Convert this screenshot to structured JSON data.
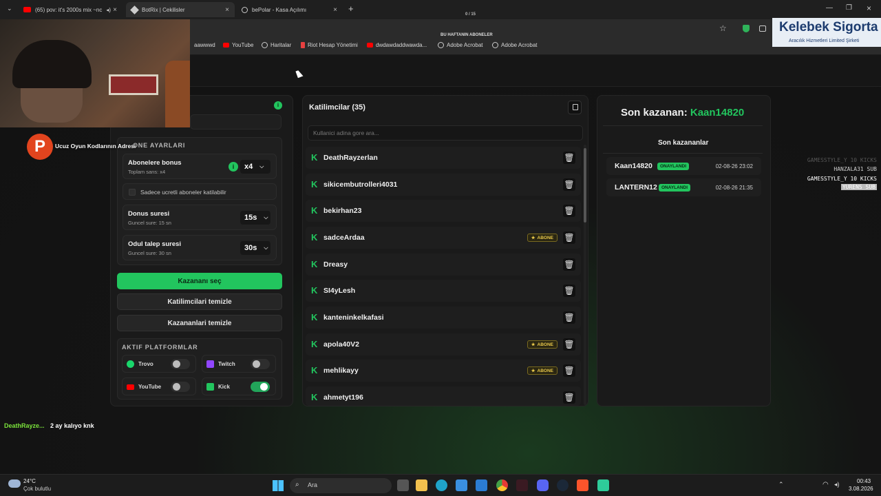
{
  "browser": {
    "tabs": [
      {
        "label": "(65) pov: it's 2000s mix ~nc",
        "icon": "youtube-icon"
      },
      {
        "label": "BotRix | Cekilisler",
        "icon": "botrix-icon"
      },
      {
        "label": "bePolar - Kasa Açılımı",
        "icon": "globe-icon"
      }
    ],
    "counter": "0 / 15",
    "banner_text": "BU HAFTANIN ABONELER",
    "bookmarks": [
      "aawwwd",
      "YouTube",
      "Haritalar",
      "Riot Hesap Yönetimi",
      "dwdawdaddwawda...",
      "Adobe Acrobat",
      "Adobe Acrobat"
    ]
  },
  "overlay": {
    "title": "Ucuz Oyun Kodlarının Adresi",
    "logo_letter": "P",
    "sponsor_name": "Kelebek Sigorta",
    "sponsor_sub": "Aracılık Hizmetleri Limited Şirketi"
  },
  "settings": {
    "section_title": "ONE AYARLARI",
    "subscriber_bonus_label": "Abonelere bonus",
    "subscriber_bonus_sub": "Toplam sans: x4",
    "subscriber_bonus_value": "x4",
    "paid_only_label": "Sadece ucretli aboneler katilabilir",
    "bonus_time_label": "Donus suresi",
    "bonus_time_sub": "Guncel sure: 15 sn",
    "bonus_time_value": "15s",
    "claim_time_label": "Odul talep suresi",
    "claim_time_sub": "Guncel sure: 30 sn",
    "claim_time_value": "30s",
    "pick_winner": "Kazananı seç",
    "clear_participants": "Katilimcilari temizle",
    "clear_winners": "Kazananlari temizle",
    "platforms_title": "AKTIF PLATFORMLAR",
    "platforms": [
      {
        "name": "Trovo",
        "color": "#19d66b",
        "on": false
      },
      {
        "name": "Twitch",
        "color": "#9146ff",
        "on": false
      },
      {
        "name": "YouTube",
        "color": "#ff0000",
        "on": false
      },
      {
        "name": "Kick",
        "color": "#22c55e",
        "on": true
      }
    ]
  },
  "participants": {
    "title": "Katilimcilar (35)",
    "search_placeholder": "Kullanici adina gore ara...",
    "abone_label": "ABONE",
    "items": [
      {
        "name": "DeathRayzerlan",
        "sub": false
      },
      {
        "name": "sikicembutrolleri4031",
        "sub": false
      },
      {
        "name": "bekirhan23",
        "sub": false
      },
      {
        "name": "sadceArdaa",
        "sub": true
      },
      {
        "name": "Dreasy",
        "sub": false
      },
      {
        "name": "SI4yLesh",
        "sub": false
      },
      {
        "name": "kanteninkelkafasi",
        "sub": false
      },
      {
        "name": "apola40V2",
        "sub": true
      },
      {
        "name": "mehlikayy",
        "sub": true
      },
      {
        "name": "ahmetyt196",
        "sub": false
      }
    ]
  },
  "winners": {
    "last_winner_label": "Son kazanan:",
    "last_winner": "Kaan14820",
    "recent_title": "Son kazananlar",
    "badge": "ONAYLANDI",
    "items": [
      {
        "name": "Kaan14820",
        "time": "02-08-26 23:02"
      },
      {
        "name": "LANTERN12",
        "time": "02-08-26 21:35"
      }
    ]
  },
  "subs_feed": [
    "GAMESSTYLE_Y 10 KICKS",
    "HANZALA31 SUB",
    "GAMESSTYLE_Y 10 KICKS",
    "YURENS SUB"
  ],
  "chat": {
    "user": "DeathRayze...",
    "message": "2 ay kalıyo knk"
  },
  "taskbar": {
    "weather_temp": "24°C",
    "weather_desc": "Çok bulutlu",
    "search": "Ara",
    "time": "00:43",
    "date": "3.08.2026"
  },
  "colors": {
    "accent": "#22c55e",
    "background": "#131313",
    "panel": "#1a1a1a"
  }
}
